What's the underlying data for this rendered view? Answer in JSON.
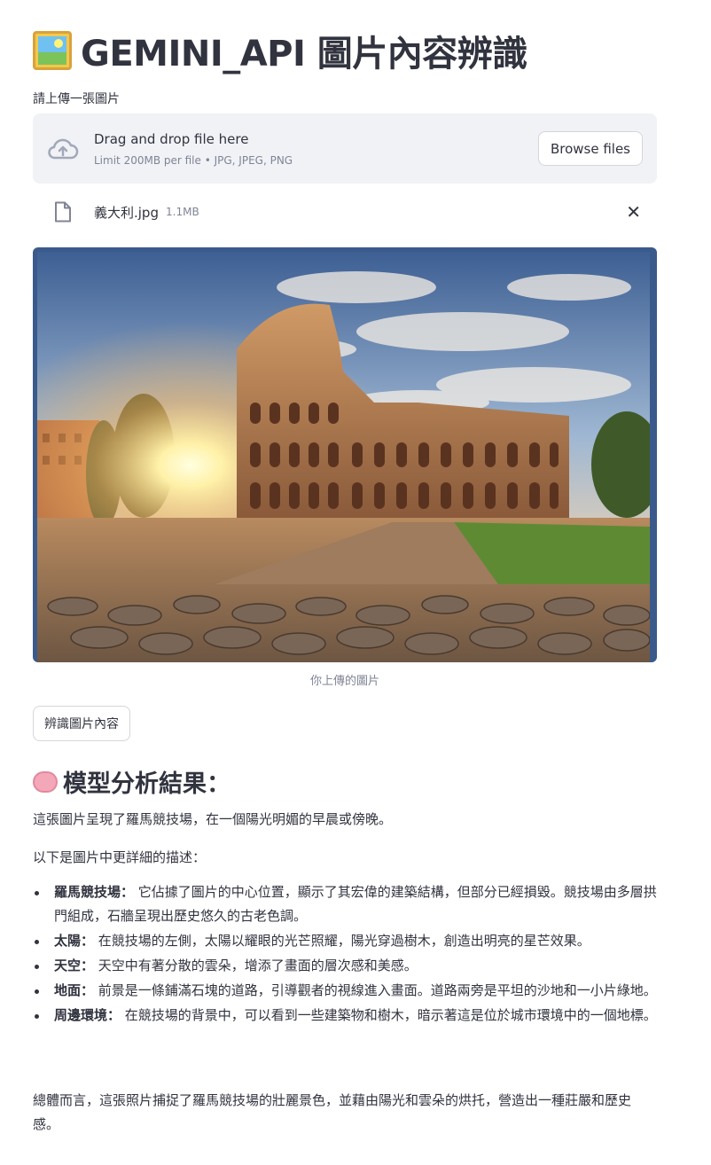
{
  "header": {
    "title": "GEMINI_API 圖片內容辨識",
    "title_icon": "framed-picture-icon"
  },
  "uploader": {
    "label": "請上傳一張圖片",
    "drop_title": "Drag and drop file here",
    "drop_limit": "Limit 200MB per file • JPG, JPEG, PNG",
    "browse_label": "Browse files",
    "file_name": "義大利.jpg",
    "file_size": "1.1MB",
    "remove_icon": "✕"
  },
  "image": {
    "caption": "你上傳的圖片"
  },
  "actions": {
    "analyze_label": "辨識圖片內容"
  },
  "result": {
    "heading": "模型分析結果：",
    "intro": "這張圖片呈現了羅馬競技場，在一個陽光明媚的早晨或傍晚。",
    "detail_lead": "以下是圖片中更詳細的描述：",
    "items": [
      {
        "term": "羅馬競技場：",
        "text": " 它佔據了圖片的中心位置，顯示了其宏偉的建築結構，但部分已經損毀。競技場由多層拱門組成，石牆呈現出歷史悠久的古老色調。"
      },
      {
        "term": "太陽：",
        "text": " 在競技場的左側，太陽以耀眼的光芒照耀，陽光穿過樹木，創造出明亮的星芒效果。"
      },
      {
        "term": "天空：",
        "text": " 天空中有著分散的雲朵，增添了畫面的層次感和美感。"
      },
      {
        "term": "地面：",
        "text": " 前景是一條鋪滿石塊的道路，引導觀者的視線進入畫面。道路兩旁是平坦的沙地和一小片綠地。"
      },
      {
        "term": "周邊環境：",
        "text": " 在競技場的背景中，可以看到一些建築物和樹木，暗示著這是位於城市環境中的一個地標。"
      }
    ],
    "summary": "總體而言，這張照片捕捉了羅馬競技場的壯麗景色，並藉由陽光和雲朵的烘托，營造出一種莊嚴和歷史感。"
  }
}
